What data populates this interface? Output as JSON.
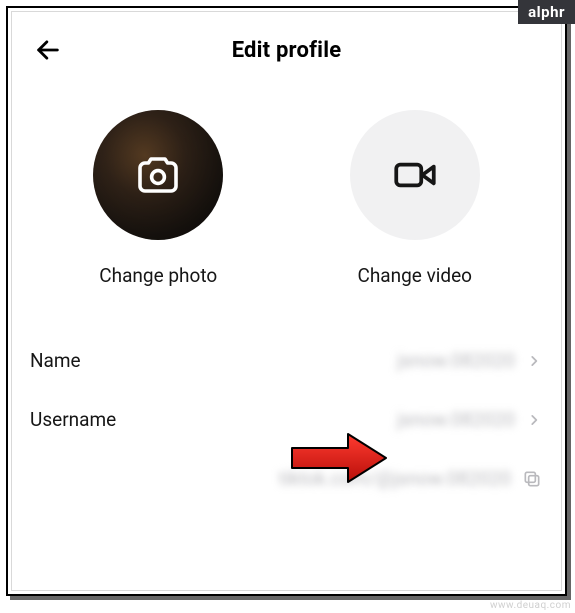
{
  "header": {
    "title": "Edit profile"
  },
  "media": {
    "photo_label": "Change photo",
    "video_label": "Change video"
  },
  "rows": {
    "name": {
      "label": "Name",
      "value": "jsnow.082020"
    },
    "username": {
      "label": "Username",
      "value": "jsnow.082020"
    }
  },
  "profile_link": {
    "text": "tiktok.com/@jsnow.082020"
  },
  "badge": "alphr",
  "watermark": "www.deuaq.com",
  "icons": {
    "back": "arrow-left-icon",
    "camera": "camera-icon",
    "video": "video-icon",
    "chevron": "chevron-right-icon",
    "copy": "copy-icon"
  }
}
